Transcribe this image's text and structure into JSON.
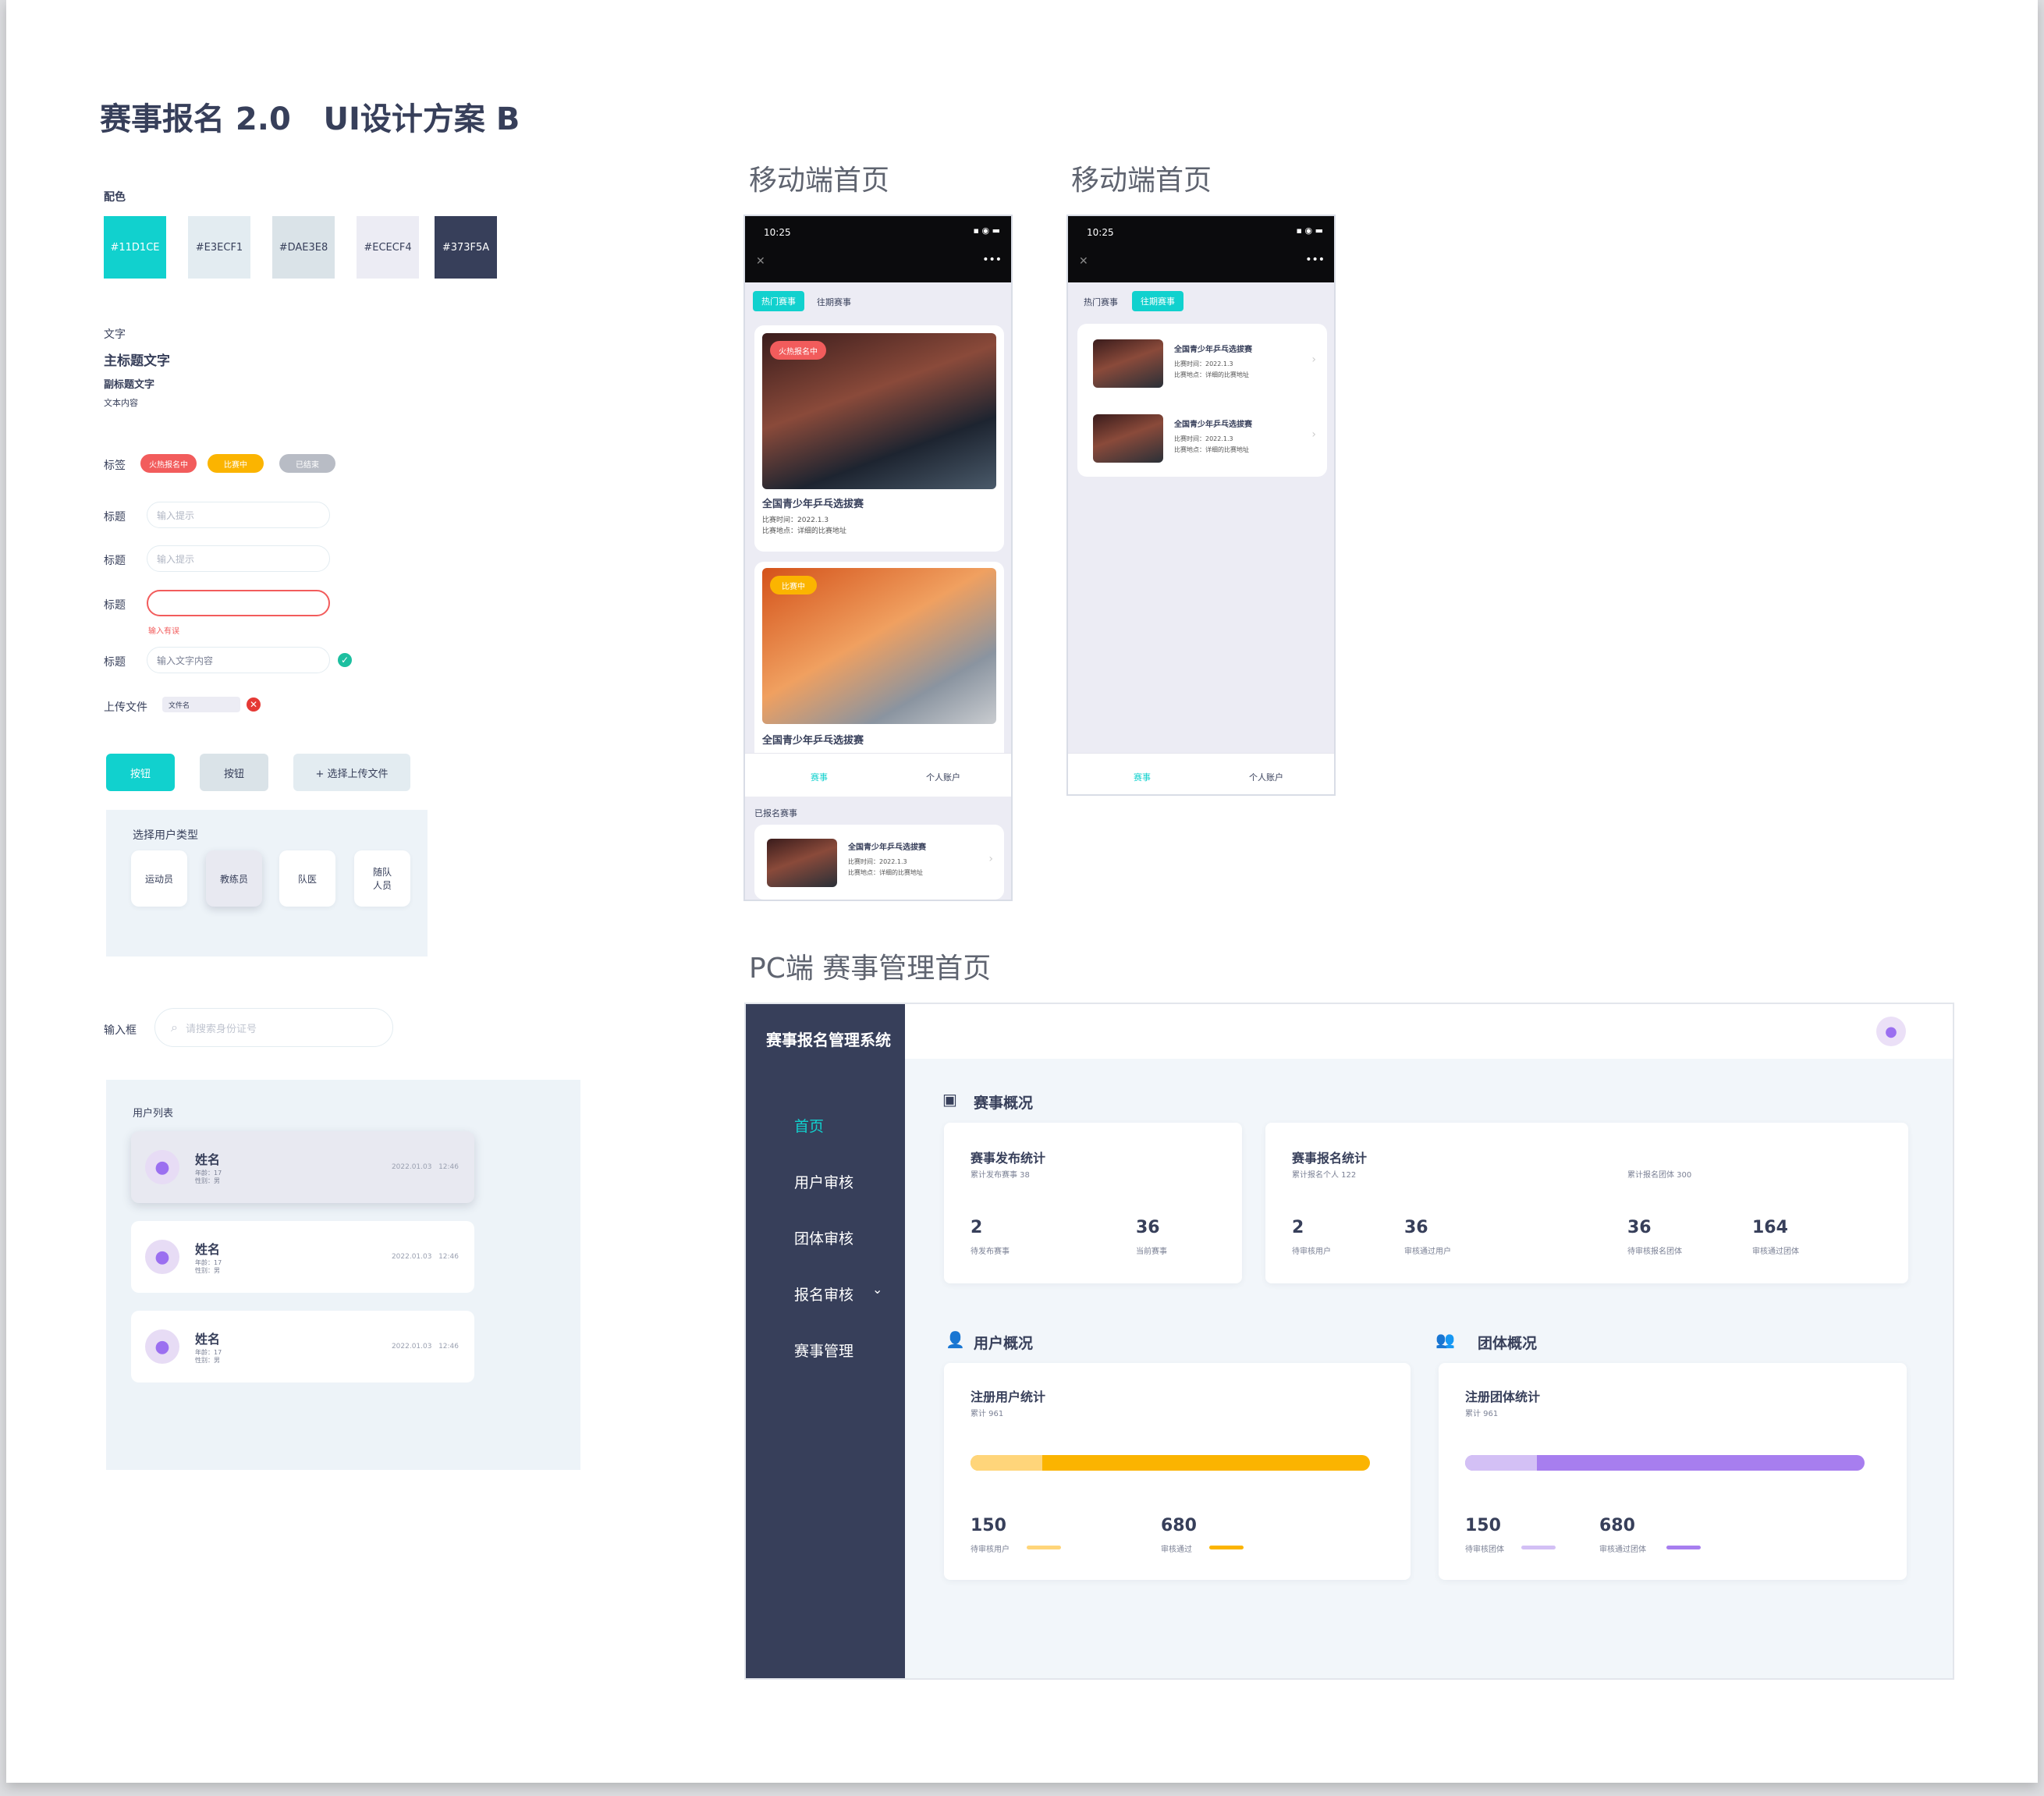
{
  "page_title": "赛事报名 2.0   UI设计方案 B",
  "colors": {
    "label": "配色",
    "swatches": [
      {
        "hex": "#11D1CE",
        "label": "#11D1CE"
      },
      {
        "hex": "#E3ECF1",
        "label": "#E3ECF1"
      },
      {
        "hex": "#DAE3E8",
        "label": "#DAE3E8"
      },
      {
        "hex": "#ECECF4",
        "label": "#ECECF4"
      },
      {
        "hex": "#373F5A",
        "label": "#373F5A"
      }
    ]
  },
  "typography": {
    "label": "文字",
    "main_title": "主标题文字",
    "sub_title": "副标题文字",
    "body": "文本内容"
  },
  "tags": {
    "label": "标签",
    "items": [
      "火热报名中",
      "比赛中",
      "已结束"
    ]
  },
  "form": {
    "field_label": "标题",
    "placeholder": "输入提示",
    "error_text": "输入有误",
    "filled_placeholder": "输入文字内容",
    "upload_label": "上传文件",
    "upload_filename": "文件名"
  },
  "buttons": {
    "primary": "按钮",
    "secondary": "按钮",
    "upload": "+ 选择上传文件"
  },
  "user_type": {
    "title": "选择用户类型",
    "options": [
      "运动员",
      "教练员",
      "队医",
      "随队\n人员"
    ]
  },
  "search": {
    "label": "输入框",
    "placeholder": "请搜索身份证号"
  },
  "user_list": {
    "title": "用户列表",
    "items": [
      {
        "name": "姓名",
        "age": "年龄：17",
        "gender": "性别：男",
        "date": "2022.01.03",
        "time": "12:46"
      },
      {
        "name": "姓名",
        "age": "年龄：17",
        "gender": "性别：男",
        "date": "2022.01.03",
        "time": "12:46"
      },
      {
        "name": "姓名",
        "age": "年龄：17",
        "gender": "性别：男",
        "date": "2022.01.03",
        "time": "12:46"
      }
    ]
  },
  "mobile1": {
    "section_title": "移动端首页",
    "time": "10:25",
    "tabs": [
      "热门赛事",
      "往期赛事"
    ],
    "events": [
      {
        "badge": "火热报名中",
        "title": "全国青少年乒乓选拔赛",
        "time": "比赛时间：2022.1.3",
        "place": "比赛地点：详细的比赛地址"
      },
      {
        "badge": "比赛中",
        "title": "全国青少年乒乓选拔赛"
      }
    ],
    "bottom_nav": [
      "赛事",
      "个人账户"
    ],
    "registered_label": "已报名赛事",
    "registered": {
      "title": "全国青少年乒乓选拔赛",
      "time": "比赛时间：2022.1.3",
      "place": "比赛地点：详细的比赛地址"
    }
  },
  "mobile2": {
    "section_title": "移动端首页",
    "time": "10:25",
    "tabs": [
      "热门赛事",
      "往期赛事"
    ],
    "events": [
      {
        "title": "全国青少年乒乓选拔赛",
        "time": "比赛时间：2022.1.3",
        "place": "比赛地点：详细的比赛地址"
      },
      {
        "title": "全国青少年乒乓选拔赛",
        "time": "比赛时间：2022.1.3",
        "place": "比赛地点：详细的比赛地址"
      }
    ],
    "bottom_nav": [
      "赛事",
      "个人账户"
    ]
  },
  "pc": {
    "section_title": "PC端 赛事管理首页",
    "app_name": "赛事报名管理系统",
    "nav": [
      "首页",
      "用户审核",
      "团体审核",
      "报名审核",
      "赛事管理"
    ],
    "overview_title": "赛事概况",
    "publish": {
      "title": "赛事发布统计",
      "sub": "累计发布赛事 38",
      "v1": "2",
      "l1": "待发布赛事",
      "v2": "36",
      "l2": "当前赛事"
    },
    "signup": {
      "title": "赛事报名统计",
      "sub_left": "累计报名个人 122",
      "sub_right": "累计报名团体 300",
      "v1": "2",
      "l1": "待审核用户",
      "v2": "36",
      "l2": "审核通过用户",
      "v3": "36",
      "l3": "待审核报名团体",
      "v4": "164",
      "l4": "审核通过团体"
    },
    "user_section": "用户概况",
    "team_section": "团体概况",
    "user_stats": {
      "title": "注册用户统计",
      "sub": "累计 961",
      "pending": "150",
      "pending_label": "待审核用户",
      "passed": "680",
      "passed_label": "审核通过",
      "pending_frac": 0.18
    },
    "team_stats": {
      "title": "注册团体统计",
      "sub": "累计 961",
      "pending": "150",
      "pending_label": "待审核团体",
      "passed": "680",
      "passed_label": "审核通过团体",
      "pending_frac": 0.18
    }
  }
}
